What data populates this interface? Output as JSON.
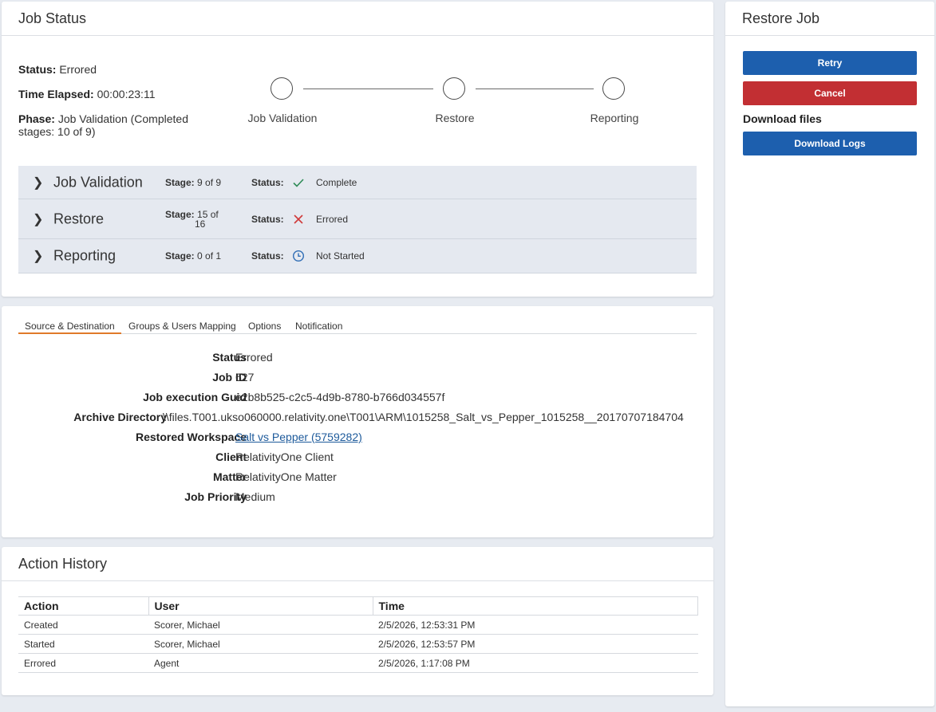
{
  "job_status": {
    "title": "Job Status",
    "status_label": "Status:",
    "status_value": "Errored",
    "time_label": "Time Elapsed:",
    "time_value": "00:00:23:11",
    "phase_label": "Phase:",
    "phase_value_line1": "Job Validation (Completed",
    "phase_value_line2": "stages: 10 of 9)",
    "steps": [
      "Job Validation",
      "Restore",
      "Reporting"
    ],
    "stages": [
      {
        "name": "Job Validation",
        "stage_label": "Stage:",
        "stage_line1": "9 of 9",
        "stage_line2": "",
        "status_label": "Status:",
        "status_icon": "check-icon",
        "status": "Complete"
      },
      {
        "name": "Restore",
        "stage_label": "Stage:",
        "stage_line1": "15 of",
        "stage_line2": "16",
        "status_label": "Status:",
        "status_icon": "error-x-icon",
        "status": "Errored"
      },
      {
        "name": "Reporting",
        "stage_label": "Stage:",
        "stage_line1": "0 of 1",
        "stage_line2": "",
        "status_label": "Status:",
        "status_icon": "clock-icon",
        "status": "Not Started"
      }
    ]
  },
  "details": {
    "tabs": [
      "Source & Destination",
      "Groups & Users Mapping",
      "Options",
      "Notification"
    ],
    "active_tab": "Source & Destination",
    "fields": [
      {
        "label": "Status",
        "value": "Errored"
      },
      {
        "label": "Job ID",
        "value": "627"
      },
      {
        "label": "Job execution Guid",
        "value": "e2b8b525-c2c5-4d9b-8780-b766d034557f"
      },
      {
        "label": "Archive Directory",
        "value": "\\\\files.T001.ukso060000.relativity.one\\T001\\ARM\\1015258_Salt_vs_Pepper_1015258__20170707184704"
      },
      {
        "label": "Restored Workspace",
        "value": "Salt vs Pepper (5759282)"
      },
      {
        "label": "Client",
        "value": "RelativityOne Client"
      },
      {
        "label": "Matter",
        "value": "RelativityOne Matter"
      },
      {
        "label": "Job Priority",
        "value": "Medium"
      }
    ]
  },
  "history": {
    "title": "Action History",
    "columns": [
      "Action",
      "User",
      "Time"
    ],
    "rows": [
      [
        "Created",
        "Scorer, Michael",
        "2/5/2026, 12:53:31 PM"
      ],
      [
        "Started",
        "Scorer, Michael",
        "2/5/2026, 12:53:57 PM"
      ],
      [
        "Errored",
        "Agent",
        "2/5/2026, 1:17:08 PM"
      ]
    ]
  },
  "restore": {
    "title": "Restore Job",
    "retry_label": "Retry",
    "cancel_label": "Cancel",
    "download_heading": "Download files",
    "download_logs_label": "Download Logs"
  },
  "colors": {
    "primary": "#1d5fae",
    "danger": "#c22f33",
    "tab_accent": "#e07a2a",
    "complete": "#2e8b57",
    "errored": "#d03a3a",
    "not_started": "#2f6db5"
  }
}
